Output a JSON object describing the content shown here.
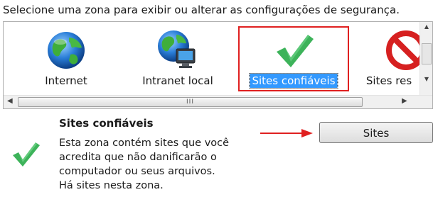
{
  "instruction": "Selecione uma zona para exibir ou alterar as configurações de segurança.",
  "zones": [
    {
      "label": "Internet",
      "icon": "globe-icon"
    },
    {
      "label": "Intranet local",
      "icon": "intranet-globe-icon"
    },
    {
      "label": "Sites confiáveis",
      "icon": "checkmark-icon",
      "selected": true
    },
    {
      "label": "Sites res",
      "icon": "restricted-icon"
    }
  ],
  "scroll": {
    "grip": "III",
    "left": "◀",
    "right": "▶",
    "up": "▲",
    "down": "▼"
  },
  "description": {
    "title": "Sites confiáveis",
    "lines": [
      "Esta zona contém sites que você",
      "acredita que não danificarão o",
      "computador ou seus arquivos.",
      "Há sites nesta zona."
    ]
  },
  "sites_button": "Sites",
  "colors": {
    "highlight": "#3399ff",
    "annotation": "#e02020",
    "check": "#3db35a"
  }
}
